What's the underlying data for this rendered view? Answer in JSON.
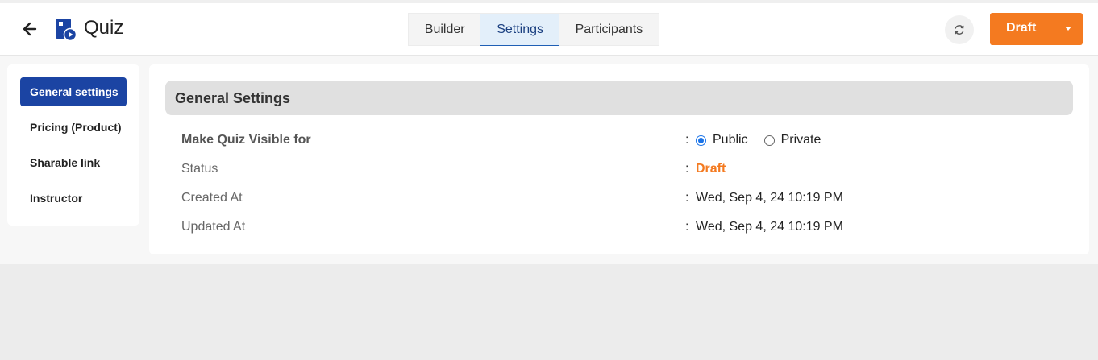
{
  "header": {
    "title": "Quiz",
    "tabs": [
      "Builder",
      "Settings",
      "Participants"
    ],
    "active_tab": "Settings",
    "status_button": "Draft",
    "back_icon": "arrow-left-icon",
    "logo_icon": "quiz-logo-icon",
    "refresh_icon": "refresh-icon",
    "caret_icon": "chevron-down-icon"
  },
  "sidebar": {
    "items": [
      "General settings",
      "Pricing (Product)",
      "Sharable link",
      "Instructor"
    ],
    "active": "General settings"
  },
  "section": {
    "title": "General Settings",
    "visibility": {
      "label": "Make Quiz Visible for",
      "options": [
        "Public",
        "Private"
      ],
      "selected": "Public"
    },
    "status": {
      "label": "Status",
      "value": "Draft"
    },
    "created": {
      "label": "Created At",
      "value": "Wed, Sep 4, 24 10:19 PM"
    },
    "updated": {
      "label": "Updated At",
      "value": "Wed, Sep 4, 24 10:19 PM"
    }
  },
  "colors": {
    "accent_orange": "#f47a20",
    "active_blue": "#1b44a3",
    "tab_active_bg": "#e3effa"
  }
}
